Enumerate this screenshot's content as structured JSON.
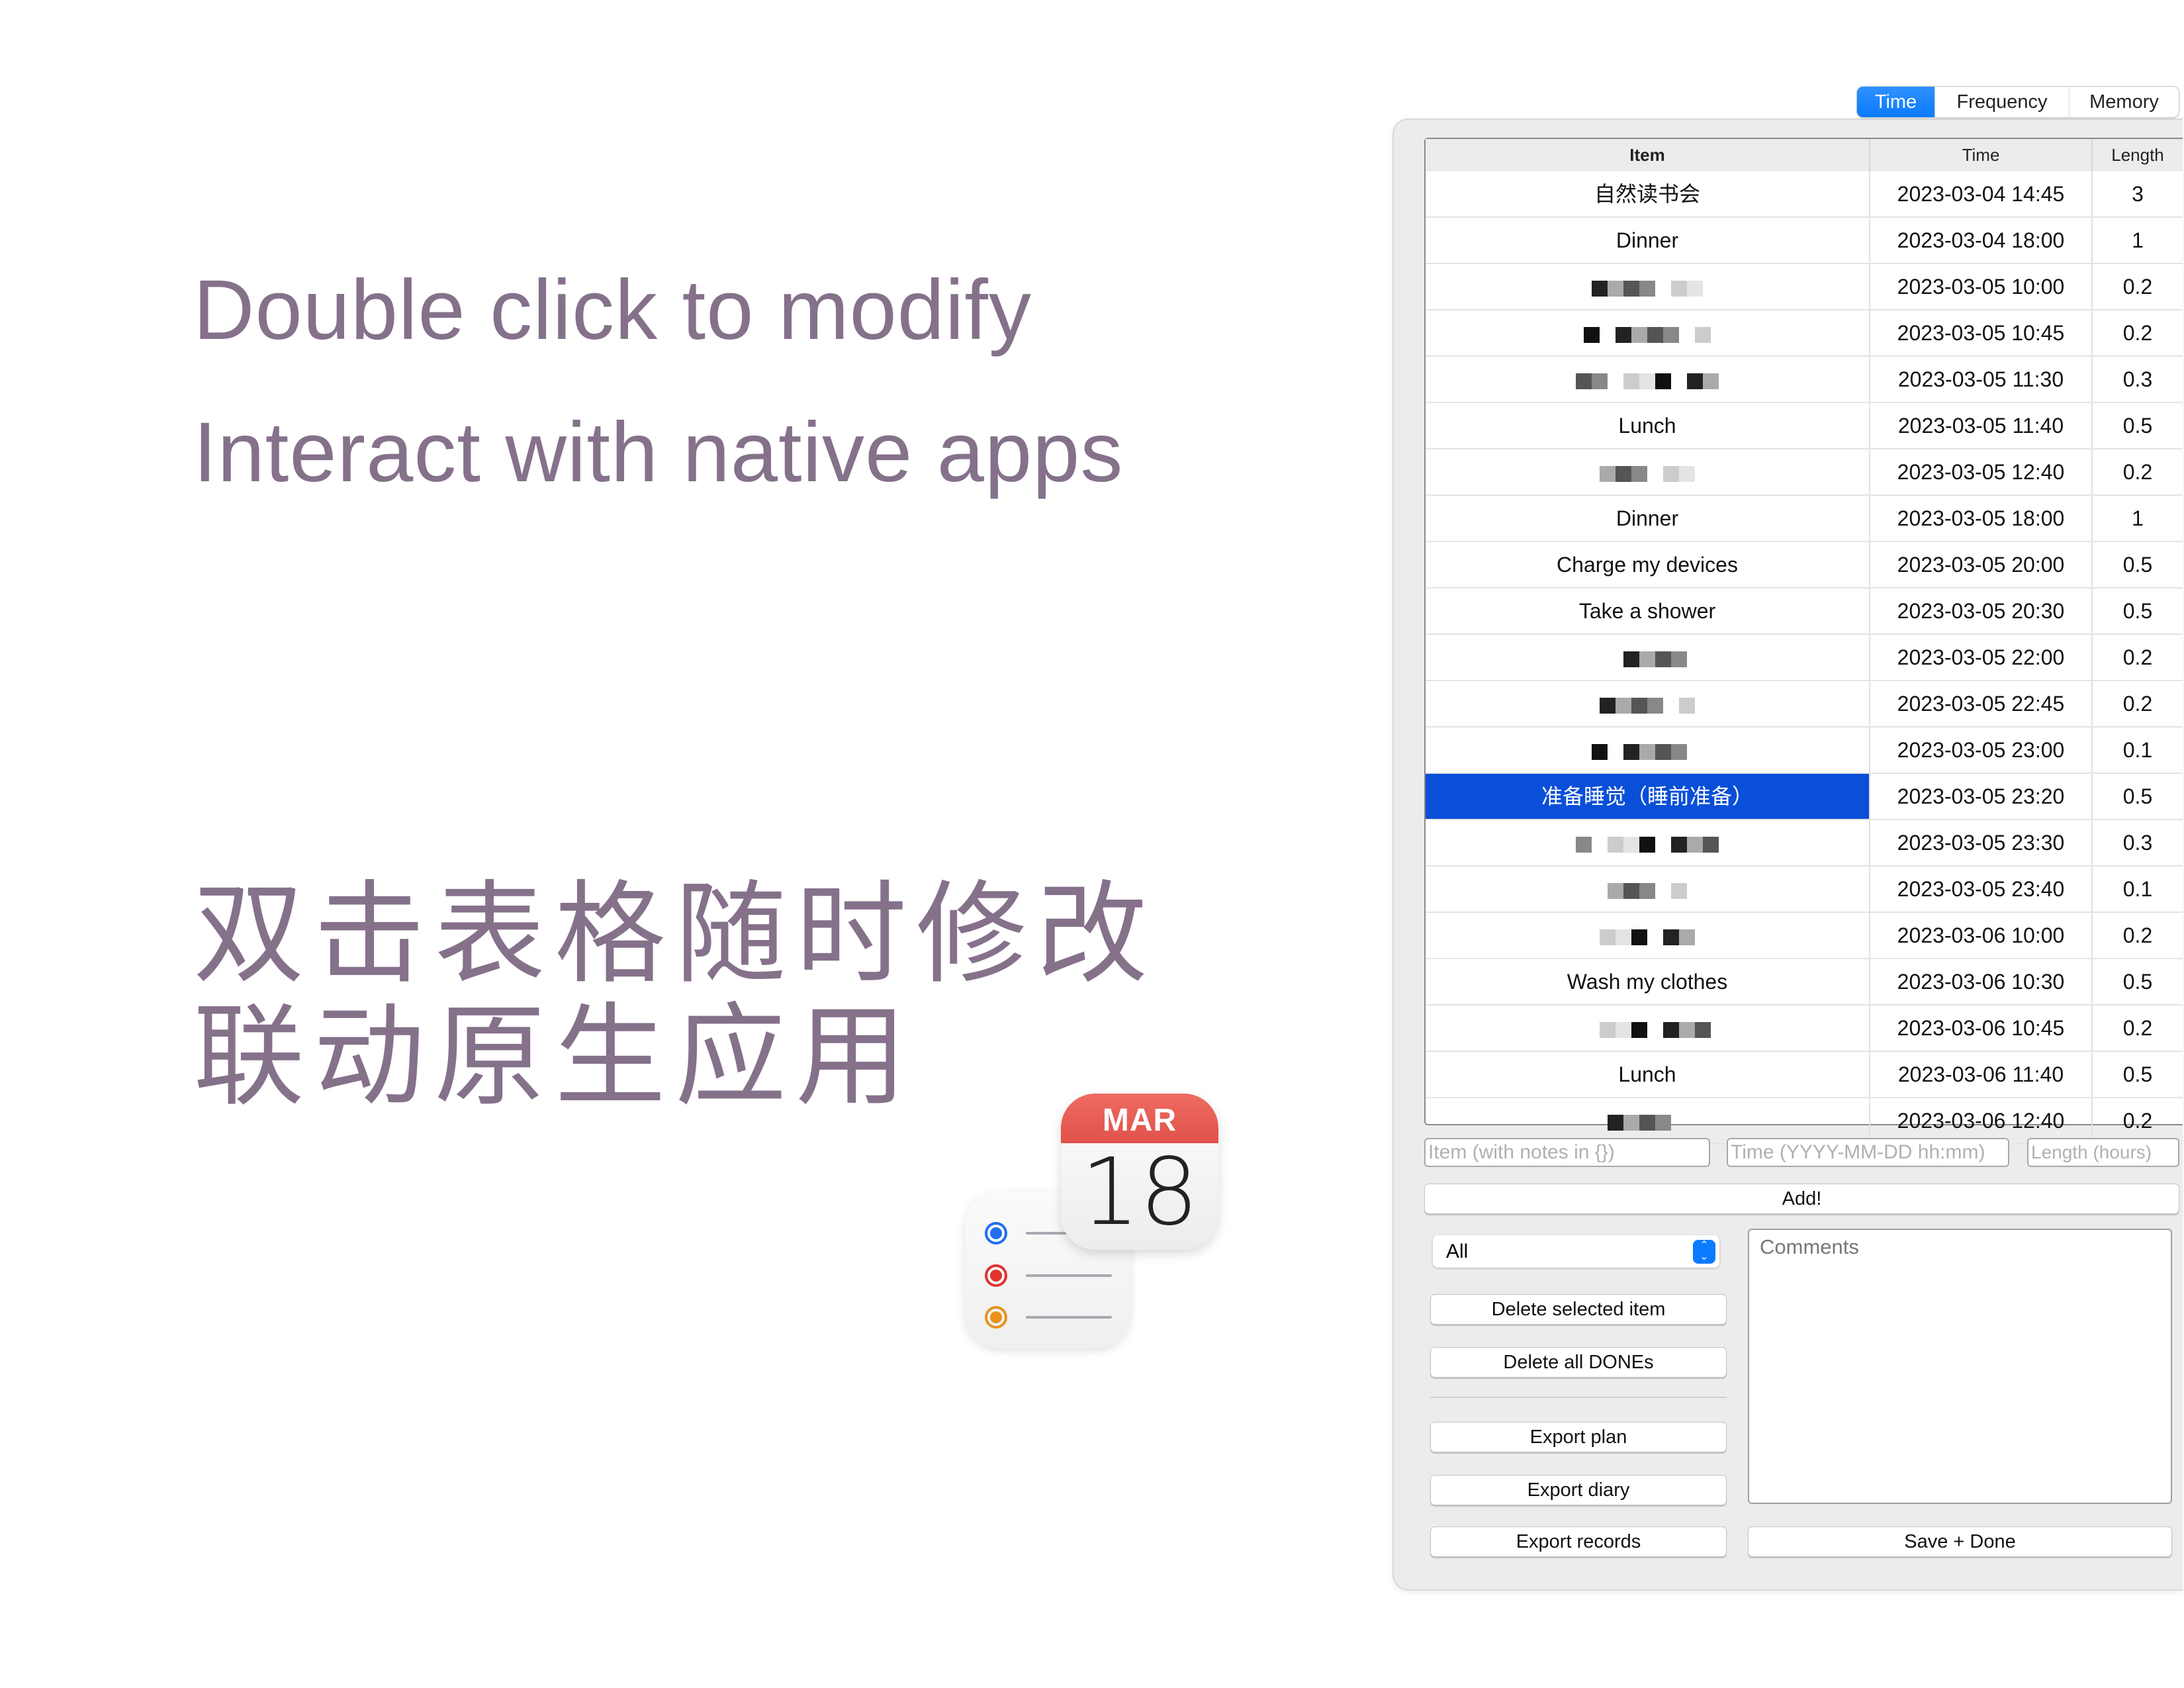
{
  "promo": {
    "line1": "Double click to modify",
    "line2": "Interact with native apps",
    "cn_line1": "双击表格随时修改",
    "cn_line2": "联动原生应用",
    "text_color": "#85718a"
  },
  "calendar_icon": {
    "month": "MAR",
    "day": "18"
  },
  "reminders_icon": {
    "dot_colors": [
      "#1f6ff0",
      "#e0332e",
      "#e8921c"
    ]
  },
  "tabs": [
    {
      "label": "Time",
      "active": true
    },
    {
      "label": "Frequency",
      "active": false
    },
    {
      "label": "Memory",
      "active": false
    }
  ],
  "table": {
    "columns": [
      "Item",
      "Time",
      "Length"
    ],
    "selection_color": "#0a4fd8",
    "rows": [
      {
        "item": "自然读书会",
        "time": "2023-03-04 14:45",
        "length": "3"
      },
      {
        "item": "Dinner",
        "time": "2023-03-04 18:00",
        "length": "1"
      },
      {
        "item": "",
        "redacted": true,
        "time": "2023-03-05 10:00",
        "length": "0.2"
      },
      {
        "item": "",
        "redacted": true,
        "time": "2023-03-05 10:45",
        "length": "0.2"
      },
      {
        "item": "",
        "redacted": true,
        "time": "2023-03-05 11:30",
        "length": "0.3"
      },
      {
        "item": "Lunch",
        "time": "2023-03-05 11:40",
        "length": "0.5"
      },
      {
        "item": "",
        "redacted": true,
        "time": "2023-03-05 12:40",
        "length": "0.2"
      },
      {
        "item": "Dinner",
        "time": "2023-03-05 18:00",
        "length": "1"
      },
      {
        "item": "Charge my devices",
        "time": "2023-03-05 20:00",
        "length": "0.5"
      },
      {
        "item": "Take a shower",
        "time": "2023-03-05 20:30",
        "length": "0.5"
      },
      {
        "item": "",
        "redacted": true,
        "time": "2023-03-05 22:00",
        "length": "0.2"
      },
      {
        "item": "",
        "redacted": true,
        "time": "2023-03-05 22:45",
        "length": "0.2"
      },
      {
        "item": "",
        "redacted": true,
        "time": "2023-03-05 23:00",
        "length": "0.1"
      },
      {
        "item": "准备睡觉（睡前准备）",
        "time": "2023-03-05 23:20",
        "length": "0.5",
        "selected": true
      },
      {
        "item": "",
        "redacted": true,
        "time": "2023-03-05 23:30",
        "length": "0.3"
      },
      {
        "item": "",
        "redacted": true,
        "time": "2023-03-05 23:40",
        "length": "0.1"
      },
      {
        "item": "",
        "redacted": true,
        "time": "2023-03-06 10:00",
        "length": "0.2"
      },
      {
        "item": "Wash my clothes",
        "time": "2023-03-06 10:30",
        "length": "0.5"
      },
      {
        "item": "",
        "redacted": true,
        "time": "2023-03-06 10:45",
        "length": "0.2"
      },
      {
        "item": "Lunch",
        "time": "2023-03-06 11:40",
        "length": "0.5"
      },
      {
        "item": "",
        "redacted": true,
        "time": "2023-03-06 12:40",
        "length": "0.2"
      }
    ]
  },
  "inputs": {
    "item_placeholder": "Item (with notes in {})",
    "time_placeholder": "Time (YYYY-MM-DD hh:mm)",
    "length_placeholder": "Length (hours)"
  },
  "buttons": {
    "add": "Add!",
    "delete_selected": "Delete selected item",
    "delete_dones": "Delete all DONEs",
    "export_plan": "Export plan",
    "export_diary": "Export diary",
    "export_records": "Export records",
    "save_done": "Save + Done"
  },
  "filter": {
    "selected": "All"
  },
  "comments": {
    "placeholder": "Comments"
  },
  "accent_color": "#0a7aff"
}
